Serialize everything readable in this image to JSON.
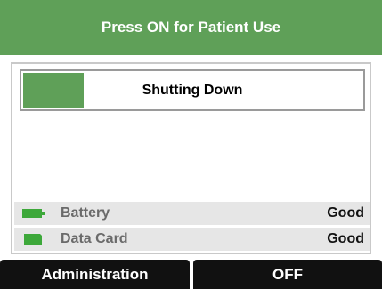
{
  "header": {
    "title": "Press ON for Patient Use"
  },
  "progress": {
    "label": "Shutting Down",
    "fraction": 0.18
  },
  "status": {
    "battery": {
      "label": "Battery",
      "value": "Good",
      "icon": "battery-icon"
    },
    "data_card": {
      "label": "Data Card",
      "value": "Good",
      "icon": "data-card-icon"
    }
  },
  "softkeys": {
    "left_label": "Administration",
    "right_label": "OFF"
  },
  "colors": {
    "accent": "#5fa058",
    "softkey_bg": "#111111",
    "status_bg": "#e6e6e6"
  }
}
